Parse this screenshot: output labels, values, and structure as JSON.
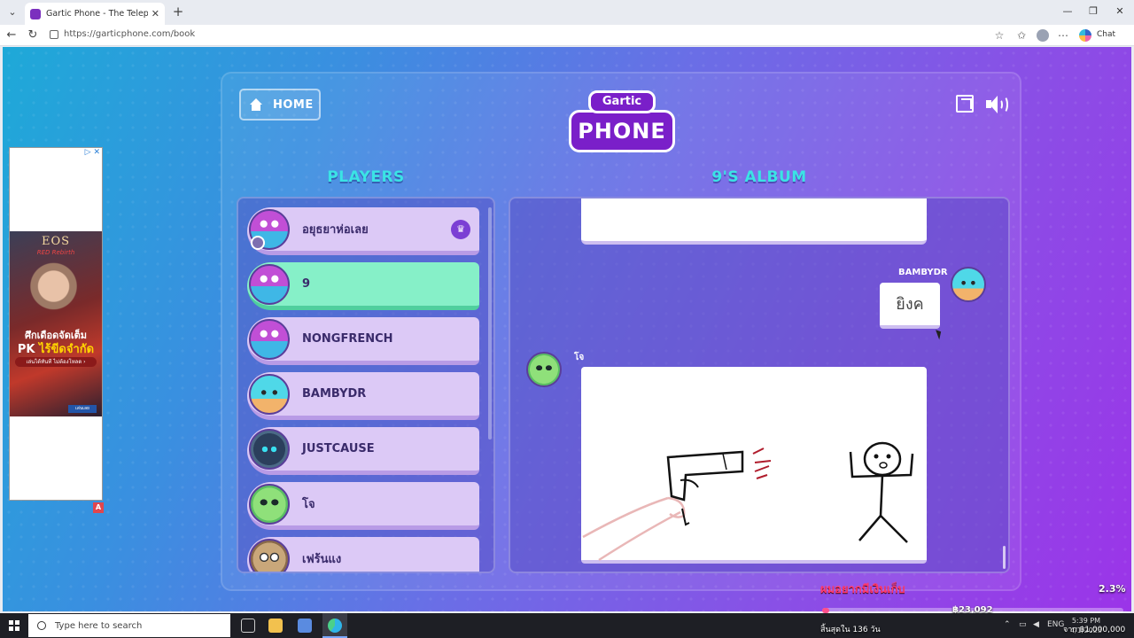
{
  "browser": {
    "tab_title": "Gartic Phone - The Telephone Game",
    "url": "https://garticphone.com/book",
    "chat_label": "Chat"
  },
  "ad": {
    "logo": "EOS",
    "logo_sub": "RED Rebirth",
    "line1": "ศึกเดือดจัดเต็ม",
    "line2_a": "PK ",
    "line2_b": "ไร้ขีดจำกัด",
    "cta": "เล่นได้ทันที ไม่ต้องโหลด ›",
    "button": "เล่นเลย"
  },
  "game": {
    "home_label": "HOME",
    "logo_top": "Gartic",
    "logo_bottom": "PHONE",
    "players_title": "PLAYERS",
    "album_title": "9'S ALBUM",
    "players": [
      {
        "name": "อยุธยาห่อเลย",
        "avatar": "purple-bird",
        "owner": true
      },
      {
        "name": "9",
        "avatar": "purple-bird",
        "active": true
      },
      {
        "name": "NONGFRENCH",
        "avatar": "purple-bird"
      },
      {
        "name": "BAMBYDR",
        "avatar": "cyan-cupcake"
      },
      {
        "name": "JUSTCAUSE",
        "avatar": "dark-ghost"
      },
      {
        "name": "โจ",
        "avatar": "green-alien"
      },
      {
        "name": "เฟร้นแง",
        "avatar": "brown-owl"
      }
    ],
    "album": {
      "bubble_author": "BAMBYDR",
      "bubble_text": "ยิงค",
      "drawing_author": "โจ"
    }
  },
  "donation": {
    "title": "ผมอยากมีเงินเก็บ",
    "amount": "฿23,092",
    "percent_label": "2.3%",
    "progress": 0.023,
    "days": "สิ้นสุดใน 136 วัน",
    "goal": "จาก ฿1,000,000"
  },
  "taskbar": {
    "search_placeholder": "Type here to search",
    "lang": "ENG",
    "time": "5:39 PM",
    "date": "4/1/2023"
  },
  "colors": {
    "accent_cyan": "#3be3e5",
    "active_player": "#86f0c8",
    "player_card": "#dcc9f6",
    "logo_purple": "#7a1fc9",
    "donate_pink": "#ff3a6e"
  }
}
